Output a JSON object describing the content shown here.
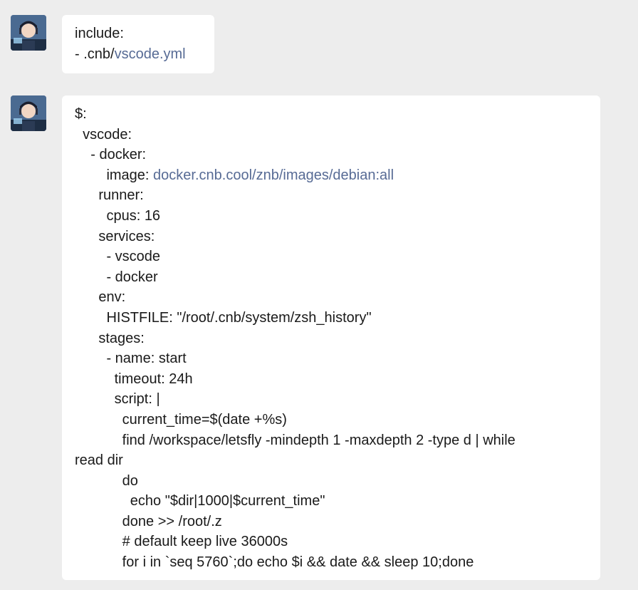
{
  "chat": {
    "messages": [
      {
        "lines": [
          {
            "text": "include:"
          },
          {
            "text": "- .cnb/",
            "link": "vscode.yml"
          }
        ]
      },
      {
        "lines": [
          {
            "text": "$:"
          },
          {
            "text": "  vscode:"
          },
          {
            "text": "    - docker:"
          },
          {
            "text": "        image: ",
            "link": "docker.cnb.cool/znb/images/debian:all"
          },
          {
            "text": "      runner:"
          },
          {
            "text": "        cpus: 16"
          },
          {
            "text": "      services:"
          },
          {
            "text": "        - vscode"
          },
          {
            "text": "        - docker"
          },
          {
            "text": "      env:"
          },
          {
            "text": "        HISTFILE: \"/root/.cnb/system/zsh_history\""
          },
          {
            "text": "      stages:"
          },
          {
            "text": "        - name: start"
          },
          {
            "text": "          timeout: 24h"
          },
          {
            "text": "          script: |"
          },
          {
            "text": "            current_time=$(date +%s)"
          },
          {
            "text": "            find /workspace/letsfly -mindepth 1 -maxdepth 2 -type d | while"
          },
          {
            "text": "read dir"
          },
          {
            "text": "            do"
          },
          {
            "text": "              echo \"$dir|1000|$current_time\""
          },
          {
            "text": "            done >> /root/.z"
          },
          {
            "text": "            # default keep live 36000s"
          },
          {
            "text": "            for i in `seq 5760`;do echo $i && date && sleep 10;done"
          }
        ]
      }
    ]
  }
}
